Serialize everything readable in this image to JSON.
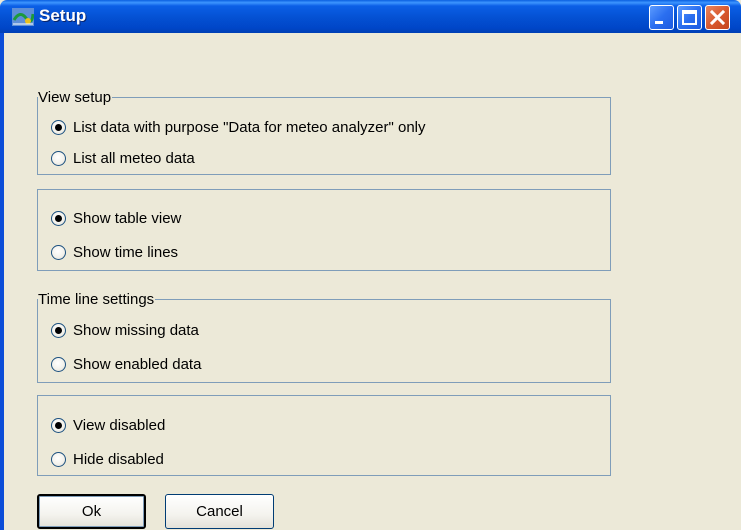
{
  "window": {
    "title": "Setup",
    "icon": "app-logo-icon",
    "controls": [
      "minimize-icon",
      "maximize-icon",
      "close-icon"
    ]
  },
  "groups": [
    {
      "legend": "View setup",
      "options": [
        {
          "label": "List data with purpose \"Data for meteo analyzer\" only",
          "selected": true
        },
        {
          "label": "List all meteo data",
          "selected": false
        }
      ]
    },
    {
      "legend": "",
      "options": [
        {
          "label": "Show table view",
          "selected": true
        },
        {
          "label": "Show time lines",
          "selected": false
        }
      ]
    },
    {
      "legend": "Time line settings",
      "options": [
        {
          "label": "Show missing data",
          "selected": true
        },
        {
          "label": "Show enabled data",
          "selected": false
        }
      ]
    },
    {
      "legend": "",
      "options": [
        {
          "label": "View disabled",
          "selected": true
        },
        {
          "label": "Hide disabled",
          "selected": false
        }
      ]
    }
  ],
  "buttons": {
    "ok": "Ok",
    "cancel": "Cancel"
  }
}
